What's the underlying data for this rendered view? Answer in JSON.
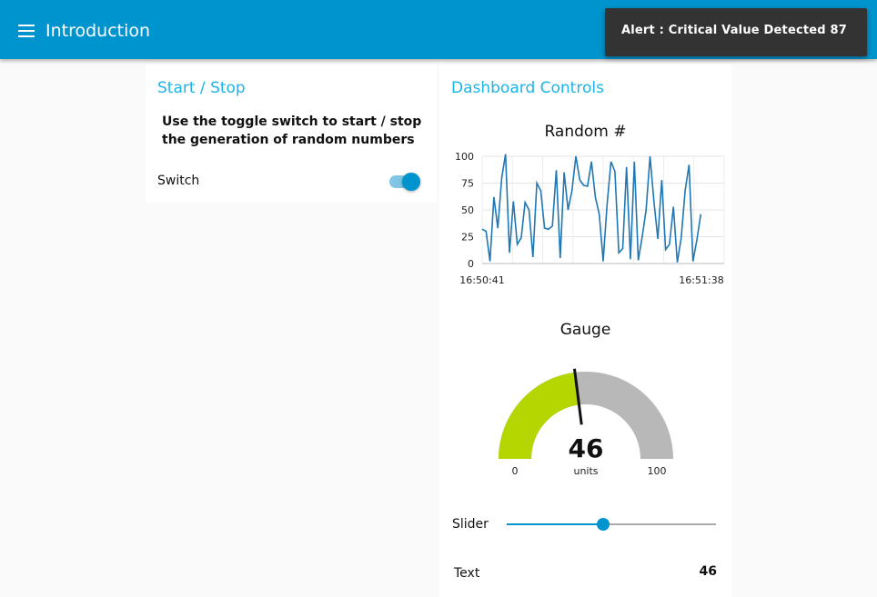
{
  "toolbar": {
    "title": "Introduction",
    "icon": "menu-icon",
    "color": "#0094ce"
  },
  "toast": {
    "message": "Alert : Critical Value Detected 87"
  },
  "start_stop": {
    "title": "Start / Stop",
    "description": "Use the toggle switch to start / stop the generation of random numbers",
    "switch_label": "Switch",
    "switch_on": true
  },
  "dashboard": {
    "title": "Dashboard Controls",
    "slider_label": "Slider",
    "slider_value": 46,
    "slider_min": 0,
    "slider_max": 100,
    "text_label": "Text",
    "text_value": "46"
  },
  "chart_data": [
    {
      "type": "line",
      "title": "Random #",
      "x_tick_labels": [
        "16:50:41",
        "16:51:38"
      ],
      "y_ticks": [
        0,
        25,
        50,
        75,
        100
      ],
      "ylim": [
        0,
        100
      ],
      "grid": true,
      "series": [
        {
          "color": "#1f77b4",
          "values": [
            32,
            30,
            2,
            62,
            33,
            80,
            102,
            10,
            58,
            18,
            24,
            57,
            50,
            6,
            75,
            68,
            33,
            32,
            35,
            87,
            5,
            85,
            50,
            68,
            100,
            78,
            73,
            72,
            95,
            62,
            46,
            2,
            55,
            95,
            86,
            10,
            14,
            90,
            4,
            95,
            3,
            25,
            50,
            100,
            58,
            23,
            78,
            13,
            18,
            53,
            1,
            24,
            68,
            92,
            2,
            22,
            46
          ]
        }
      ]
    },
    {
      "type": "gauge",
      "title": "Gauge",
      "value": 46,
      "units": "units",
      "min": 0,
      "max": 100,
      "fill_color": "#b5d600",
      "track_color": "#b8b8b8"
    }
  ]
}
